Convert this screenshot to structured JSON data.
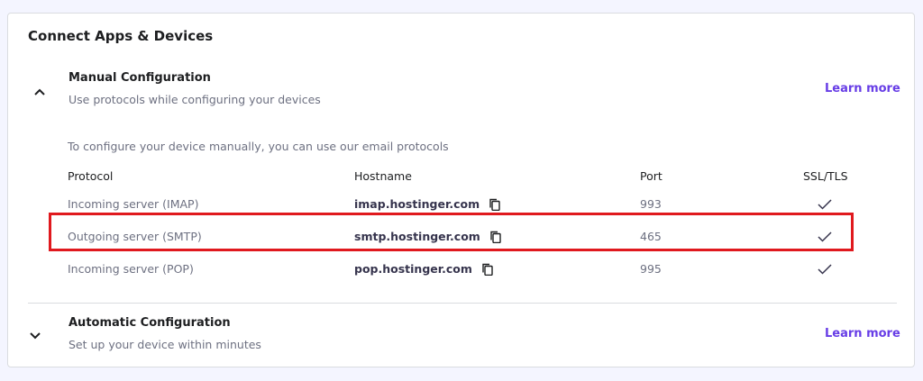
{
  "panel": {
    "title": "Connect Apps & Devices"
  },
  "manual": {
    "title": "Manual Configuration",
    "subtitle": "Use protocols while configuring your devices",
    "learn_more": "Learn more",
    "intro": "To configure your device manually, you can use our email protocols",
    "columns": {
      "protocol": "Protocol",
      "hostname": "Hostname",
      "port": "Port",
      "ssl": "SSL/TLS"
    },
    "rows": [
      {
        "protocol": "Incoming server (IMAP)",
        "hostname": "imap.hostinger.com",
        "port": "993",
        "ssl_icon": "check-icon",
        "highlighted": false
      },
      {
        "protocol": "Outgoing server (SMTP)",
        "hostname": "smtp.hostinger.com",
        "port": "465",
        "ssl_icon": "check-icon",
        "highlighted": true
      },
      {
        "protocol": "Incoming server (POP)",
        "hostname": "pop.hostinger.com",
        "port": "995",
        "ssl_icon": "check-icon",
        "highlighted": false
      }
    ]
  },
  "automatic": {
    "title": "Automatic Configuration",
    "subtitle": "Set up your device within minutes",
    "learn_more": "Learn more"
  },
  "colors": {
    "accent": "#673de6",
    "highlight": "#e0191e",
    "text": "#1d1e20",
    "muted": "#6d7081"
  }
}
